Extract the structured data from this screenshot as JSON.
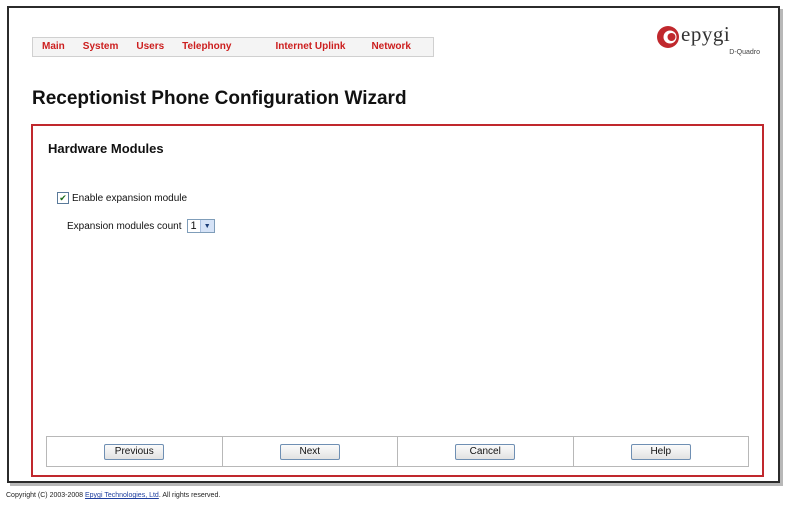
{
  "nav": {
    "items": [
      {
        "label": "Main"
      },
      {
        "label": "System"
      },
      {
        "label": "Users"
      },
      {
        "label": "Telephony"
      },
      {
        "label": "Internet Uplink"
      },
      {
        "label": "Network"
      }
    ]
  },
  "brand": {
    "name": "epygi",
    "product": "D-Quadro",
    "color": "#c0282d"
  },
  "page": {
    "title": "Receptionist Phone Configuration Wizard"
  },
  "panel": {
    "section_title": "Hardware Modules",
    "enable_label": "Enable expansion module",
    "enable_checked": true,
    "count_label": "Expansion modules count",
    "count_value": "1"
  },
  "buttons": {
    "previous": "Previous",
    "next": "Next",
    "cancel": "Cancel",
    "help": "Help"
  },
  "footer": {
    "prefix": "Copyright (C) 2003-2008 ",
    "link": "Epygi Technologies, Ltd",
    "suffix": ". All rights reserved."
  },
  "icons": {
    "logo": "epygi-logo-icon",
    "check": "checkmark-icon",
    "dropdown": "chevron-down-icon"
  }
}
